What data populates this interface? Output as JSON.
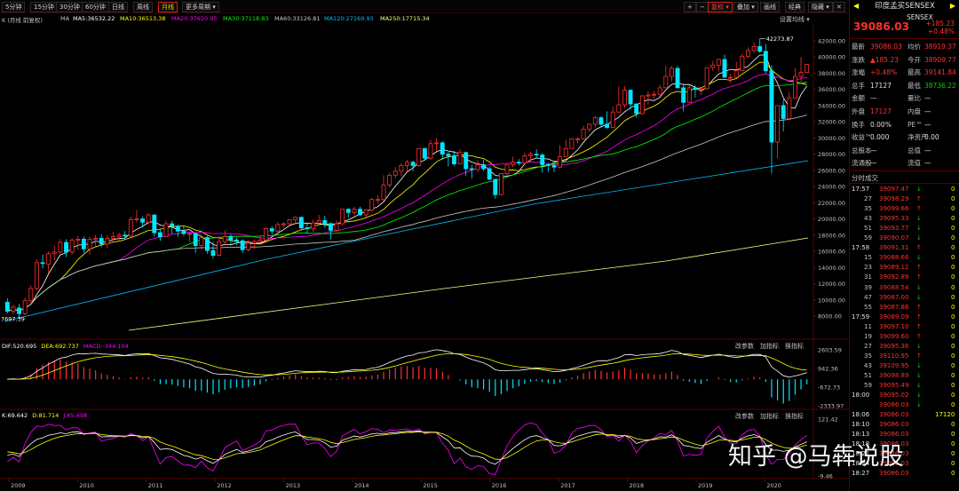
{
  "toolbar": {
    "periods": [
      "5分钟",
      "15分钟",
      "30分钟",
      "60分钟",
      "日线",
      "周线",
      "月线",
      "更多周期 ▾"
    ],
    "active_period": "月线",
    "right_buttons": [
      "+",
      "−",
      "复权 ▾",
      "叠加 ▾",
      "画线",
      "经典",
      "隐藏 ▾"
    ],
    "active_right": "复权 ▾"
  },
  "legend": {
    "prefix": "K (月线 前复权)",
    "ma_label": "MA",
    "ma5": "MA5:36532.22",
    "ma10": "MA10:36513.38",
    "ma20": "MA20:37610.95",
    "ma30": "MA30:37118.83",
    "ma60": "MA60:33126.81",
    "ma120": "MA120:27169.93",
    "ma250": "MA250:17715.34",
    "settings": "设置均线 ▾"
  },
  "colors": {
    "up": "#ff3030",
    "down": "#00e5ff",
    "ma5": "#ffffff",
    "ma10": "#ffff00",
    "ma20": "#ff00ff",
    "ma30": "#00ff00",
    "ma60": "#c8c8c8",
    "ma120": "#00bfff",
    "ma250": "#ffff80"
  },
  "price_axis": [
    "42000.00",
    "40000.00",
    "38000.00",
    "36000.00",
    "34000.00",
    "32000.00",
    "30000.00",
    "28000.00",
    "26000.00",
    "24000.00",
    "22000.00",
    "20000.00",
    "18000.00",
    "16000.00",
    "14000.00",
    "12000.00",
    "10000.00",
    "8000.00"
  ],
  "high_label": "42273.87",
  "low_label": "7697.39",
  "macd": {
    "dif": "DIF:520.695",
    "dea": "DEA:692.737",
    "macd": "MACD:-344.104",
    "axis": [
      "2603.59",
      "942.36",
      "-672.73",
      "-2333.97"
    ],
    "buttons": [
      "改参数",
      "加指标",
      "换指标"
    ]
  },
  "kdj": {
    "k": "K:69.642",
    "d": "D:81.714",
    "j": "J:65.498",
    "axis": [
      "121.42",
      "-9.46"
    ],
    "buttons": [
      "改参数",
      "加指标",
      "换指标"
    ]
  },
  "x_axis": [
    "2009",
    "2010",
    "2011",
    "2012",
    "2013",
    "2014",
    "2015",
    "2016",
    "2017",
    "2018",
    "2019",
    "2020"
  ],
  "chart_data": {
    "type": "candlestick",
    "x_range": [
      "2009",
      "2020"
    ],
    "y_range": [
      8000,
      42000
    ],
    "candles": [
      [
        9700,
        8600,
        10200,
        8300
      ],
      [
        8600,
        9100,
        9400,
        8200
      ],
      [
        9000,
        8300,
        9500,
        7697
      ],
      [
        8300,
        9900,
        10300,
        8100
      ],
      [
        9900,
        11400,
        11800,
        9600
      ],
      [
        11400,
        14600,
        15000,
        11200
      ],
      [
        14600,
        14500,
        15600,
        13900
      ],
      [
        14400,
        15700,
        16000,
        13300
      ],
      [
        15700,
        15900,
        16700,
        14900
      ],
      [
        15900,
        17100,
        17500,
        15700
      ],
      [
        17100,
        15900,
        17500,
        15300
      ],
      [
        15900,
        17400,
        17600,
        15600
      ],
      [
        17400,
        17500,
        17900,
        16200
      ],
      [
        17500,
        16300,
        17800,
        15800
      ],
      [
        16300,
        17500,
        17800,
        15600
      ],
      [
        17500,
        17600,
        18000,
        16500
      ],
      [
        17600,
        16900,
        18100,
        16500
      ],
      [
        16900,
        17600,
        18000,
        16400
      ],
      [
        17600,
        17800,
        18400,
        17000
      ],
      [
        17800,
        18000,
        18300,
        17200
      ],
      [
        18000,
        17900,
        18500,
        17400
      ],
      [
        17900,
        19900,
        20300,
        17800
      ],
      [
        19900,
        20000,
        21100,
        19600
      ],
      [
        20000,
        19600,
        20300,
        19000
      ],
      [
        19600,
        20500,
        20700,
        19300
      ],
      [
        20500,
        18300,
        20500,
        17800
      ],
      [
        18300,
        17800,
        18700,
        17300
      ],
      [
        17800,
        19400,
        19800,
        17800
      ],
      [
        19400,
        19100,
        19800,
        18100
      ],
      [
        19100,
        18500,
        19300,
        17800
      ],
      [
        18500,
        18200,
        19100,
        17900
      ],
      [
        18200,
        18200,
        18400,
        17200
      ],
      [
        18200,
        16700,
        18300,
        15800
      ],
      [
        16700,
        17700,
        18000,
        16200
      ],
      [
        17700,
        16100,
        17900,
        15700
      ],
      [
        16100,
        15500,
        17200,
        15100
      ],
      [
        15500,
        17200,
        17800,
        15400
      ],
      [
        17200,
        17800,
        18600,
        16700
      ],
      [
        17800,
        17400,
        18100,
        16900
      ],
      [
        17400,
        17300,
        17700,
        16800
      ],
      [
        17300,
        16200,
        17500,
        15800
      ],
      [
        16200,
        17000,
        17400,
        16000
      ],
      [
        17000,
        17200,
        17500,
        16300
      ],
      [
        17200,
        17400,
        17900,
        16800
      ],
      [
        17400,
        18800,
        19000,
        17200
      ],
      [
        18800,
        18500,
        19100,
        18100
      ],
      [
        18500,
        19300,
        19600,
        18100
      ],
      [
        19300,
        19400,
        19600,
        18900
      ],
      [
        19400,
        19900,
        20000,
        19200
      ],
      [
        19900,
        20200,
        20300,
        19300
      ],
      [
        20200,
        18900,
        20300,
        18600
      ],
      [
        18900,
        18800,
        19600,
        18200
      ],
      [
        18800,
        19500,
        19900,
        18400
      ],
      [
        19500,
        19800,
        20500,
        19200
      ],
      [
        19800,
        19400,
        20400,
        18900
      ],
      [
        19400,
        18600,
        19600,
        17500
      ],
      [
        18600,
        19400,
        19800,
        18400
      ],
      [
        19400,
        21200,
        21200,
        19200
      ],
      [
        21200,
        20800,
        21300,
        20100
      ],
      [
        20800,
        21200,
        21500,
        20500
      ],
      [
        21200,
        20500,
        21500,
        20400
      ],
      [
        20500,
        21100,
        21200,
        20200
      ],
      [
        21100,
        22400,
        22600,
        20900
      ],
      [
        22400,
        22400,
        22900,
        21900
      ],
      [
        22400,
        24200,
        25400,
        22200
      ],
      [
        24200,
        25400,
        25700,
        23900
      ],
      [
        25400,
        25900,
        26400,
        25000
      ],
      [
        25900,
        26600,
        26900,
        25300
      ],
      [
        26600,
        27000,
        27300,
        25900
      ],
      [
        27000,
        26600,
        27200,
        25900
      ],
      [
        26600,
        28700,
        28800,
        26500
      ],
      [
        28700,
        27500,
        28800,
        27200
      ],
      [
        27500,
        29300,
        29800,
        27300
      ],
      [
        29300,
        29400,
        30000,
        28400
      ],
      [
        29400,
        28000,
        29600,
        27300
      ],
      [
        28000,
        27800,
        28300,
        26500
      ],
      [
        27800,
        26800,
        28400,
        26600
      ],
      [
        26800,
        28200,
        28600,
        27000
      ],
      [
        28200,
        26200,
        28300,
        25300
      ],
      [
        26200,
        26100,
        26700,
        25000
      ],
      [
        26100,
        26700,
        27300,
        25800
      ],
      [
        26700,
        26200,
        27300,
        25900
      ],
      [
        26200,
        24900,
        26500,
        24800
      ],
      [
        24900,
        23000,
        24900,
        22500
      ],
      [
        23000,
        25600,
        25600,
        22900
      ],
      [
        25600,
        26700,
        26800,
        25300
      ],
      [
        26700,
        27000,
        27700,
        26400
      ],
      [
        27000,
        26900,
        27400,
        26600
      ],
      [
        26900,
        27800,
        28200,
        26700
      ],
      [
        27800,
        28000,
        28300,
        27000
      ],
      [
        28000,
        27900,
        28600,
        27500
      ],
      [
        27900,
        26700,
        28100,
        25700
      ],
      [
        26700,
        26600,
        26900,
        25800
      ],
      [
        26600,
        26400,
        27000,
        25800
      ],
      [
        26400,
        27700,
        29100,
        26200
      ],
      [
        27700,
        28700,
        29800,
        28600
      ],
      [
        28700,
        29900,
        30000,
        29300
      ],
      [
        29900,
        29900,
        30100,
        29300
      ],
      [
        29900,
        31100,
        31500,
        29800
      ],
      [
        31100,
        31700,
        31800,
        30700
      ],
      [
        31700,
        32500,
        32700,
        31300
      ],
      [
        32500,
        31700,
        32700,
        31300
      ],
      [
        31700,
        31300,
        33300,
        31100
      ],
      [
        31300,
        33200,
        33900,
        33200
      ],
      [
        33200,
        34100,
        36400,
        33200
      ],
      [
        34100,
        35900,
        36400,
        33700
      ],
      [
        35900,
        34200,
        36000,
        33500
      ],
      [
        34200,
        33000,
        34300,
        32500
      ],
      [
        33000,
        35200,
        35300,
        32900
      ],
      [
        35200,
        35300,
        35800,
        34100
      ],
      [
        35300,
        35400,
        35800,
        34800
      ],
      [
        35400,
        36200,
        36600,
        35100
      ],
      [
        36200,
        37600,
        38900,
        36200
      ],
      [
        37600,
        38600,
        38900,
        37000
      ],
      [
        38600,
        36200,
        38900,
        36200
      ],
      [
        36200,
        34400,
        36600,
        33300
      ],
      [
        34400,
        36200,
        36600,
        34400
      ],
      [
        36200,
        36000,
        36500,
        35000
      ],
      [
        36000,
        36100,
        36300,
        35300
      ],
      [
        36100,
        38700,
        38700,
        35900
      ],
      [
        38700,
        39000,
        39500,
        38300
      ],
      [
        39000,
        39700,
        39800,
        38200
      ],
      [
        39700,
        37500,
        40300,
        37500
      ],
      [
        37500,
        37500,
        37900,
        36800
      ],
      [
        37500,
        38300,
        39400,
        37400
      ],
      [
        38300,
        40100,
        40400,
        38300
      ],
      [
        40100,
        40800,
        41200,
        39900
      ],
      [
        40800,
        41300,
        41800,
        40500
      ],
      [
        41300,
        40700,
        42273,
        40500
      ],
      [
        40700,
        38300,
        41600,
        38000
      ],
      [
        38300,
        29500,
        39000,
        25600
      ],
      [
        29500,
        34000,
        34000,
        27500
      ],
      [
        34000,
        32400,
        34800,
        30800
      ],
      [
        32400,
        34900,
        35700,
        32300
      ],
      [
        34900,
        37600,
        38600,
        34900
      ],
      [
        37600,
        38100,
        40000,
        36900
      ],
      [
        38100,
        39086,
        39142,
        38736
      ]
    ]
  },
  "panel": {
    "title": "印度孟买SENSEX",
    "code": "SENSEX",
    "price": "39086.03",
    "change": "+185.23",
    "pct": "+0.48%",
    "rows": [
      {
        "l1": "最新",
        "v1": "39086.03",
        "l2": "均价",
        "v2": "38919.37"
      },
      {
        "l1": "涨跌",
        "v1": "▲185.23",
        "l2": "今开",
        "v2": "38909.77"
      },
      {
        "l1": "涨幅",
        "v1": "+0.48%",
        "l2": "最高",
        "v2": "39141.84"
      },
      {
        "l1": "总手",
        "v1": "17127",
        "l2": "最低",
        "v2": "38736.22"
      },
      {
        "l1": "金额",
        "v1": "—",
        "l2": "量比",
        "v2": "—"
      },
      {
        "l1": "外盘",
        "v1": "17127",
        "l2": "内盘",
        "v2": "—"
      },
      {
        "l1": "换手",
        "v1": "0.00%",
        "l2": "PE™",
        "v2": "—"
      },
      {
        "l1": "收益™",
        "v1": "0.000",
        "l2": "净资产",
        "v2": "0.00"
      },
      {
        "l1": "总股本",
        "v1": "—",
        "l2": "总值",
        "v2": "—"
      },
      {
        "l1": "流通股",
        "v1": "—",
        "l2": "流值",
        "v2": "—"
      }
    ],
    "ticks_title": "分时成交",
    "ticks": [
      {
        "t": "17:57",
        "p": "39097.47",
        "d": "↓",
        "v": "0"
      },
      {
        "t": "27",
        "p": "39098.29",
        "d": "↑",
        "v": "0"
      },
      {
        "t": "35",
        "p": "39099.66",
        "d": "↑",
        "v": "0"
      },
      {
        "t": "43",
        "p": "39095.33",
        "d": "↓",
        "v": "0"
      },
      {
        "t": "51",
        "p": "39093.77",
        "d": "↓",
        "v": "0"
      },
      {
        "t": "59",
        "p": "39090.07",
        "d": "↓",
        "v": "0"
      },
      {
        "t": "17:58",
        "p": "39091.31",
        "d": "↑",
        "v": "0"
      },
      {
        "t": "15",
        "p": "39088.66",
        "d": "↓",
        "v": "0"
      },
      {
        "t": "23",
        "p": "39089.12",
        "d": "↑",
        "v": "0"
      },
      {
        "t": "31",
        "p": "39092.89",
        "d": "↑",
        "v": "0"
      },
      {
        "t": "39",
        "p": "39088.54",
        "d": "↓",
        "v": "0"
      },
      {
        "t": "47",
        "p": "39087.00",
        "d": "↓",
        "v": "0"
      },
      {
        "t": "55",
        "p": "39087.88",
        "d": "↑",
        "v": "0"
      },
      {
        "t": "17:59",
        "p": "39089.09",
        "d": "↑",
        "v": "0"
      },
      {
        "t": "11",
        "p": "39097.10",
        "d": "↑",
        "v": "0"
      },
      {
        "t": "19",
        "p": "39099.60",
        "d": "↑",
        "v": "0"
      },
      {
        "t": "27",
        "p": "39095.36",
        "d": "↓",
        "v": "0"
      },
      {
        "t": "35",
        "p": "39110.95",
        "d": "↑",
        "v": "0"
      },
      {
        "t": "43",
        "p": "39109.95",
        "d": "↓",
        "v": "0"
      },
      {
        "t": "51",
        "p": "39098.89",
        "d": "↓",
        "v": "0"
      },
      {
        "t": "59",
        "p": "39095.49",
        "d": "↓",
        "v": "0"
      },
      {
        "t": "18:00",
        "p": "39095.02",
        "d": "↓",
        "v": "0"
      },
      {
        "t": "",
        "p": "39086.03",
        "d": "↓",
        "v": "0"
      },
      {
        "t": "18:06",
        "p": "39086.03",
        "d": "",
        "v": "17120"
      },
      {
        "t": "18:10",
        "p": "39086.03",
        "d": "",
        "v": "0"
      },
      {
        "t": "18:13",
        "p": "39086.03",
        "d": "",
        "v": "0"
      },
      {
        "t": "18:18",
        "p": "39086.03",
        "d": "",
        "v": "0"
      },
      {
        "t": "18:21",
        "p": "39086.03",
        "d": "",
        "v": "0"
      },
      {
        "t": "18:24",
        "p": "39086.03",
        "d": "",
        "v": "0"
      },
      {
        "t": "18:27",
        "p": "39086.03",
        "d": "",
        "v": "0"
      }
    ]
  },
  "watermark": {
    "text": "知乎 @马犇说股"
  }
}
